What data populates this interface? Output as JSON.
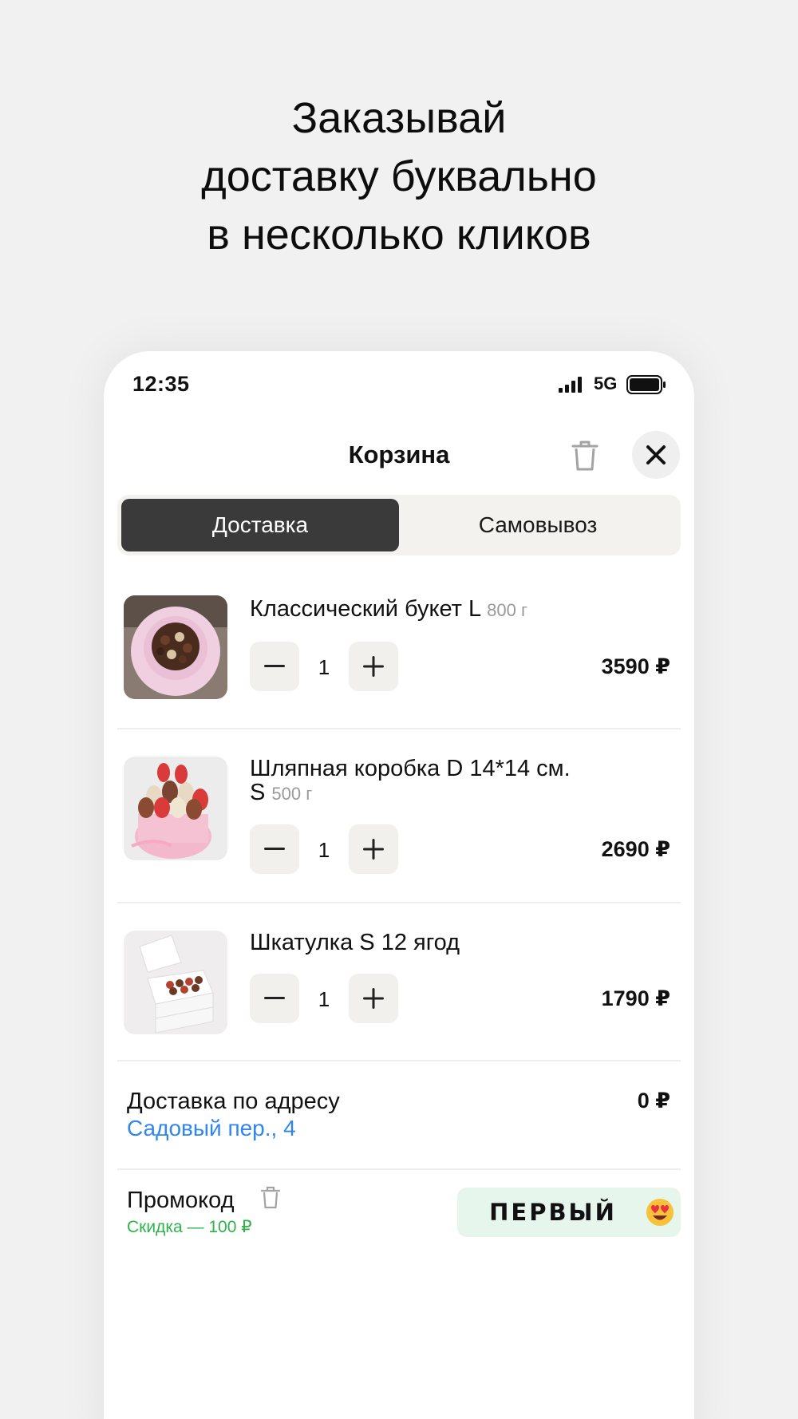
{
  "headline": {
    "line1": "Заказывай",
    "line2": "доставку буквально",
    "line3": "в несколько кликов"
  },
  "status_bar": {
    "time": "12:35",
    "network": "5G",
    "icons": [
      "signal-icon",
      "battery-icon"
    ]
  },
  "cart": {
    "title": "Корзина",
    "icons": [
      "trash-icon",
      "close-icon"
    ],
    "tabs": [
      {
        "label": "Доставка",
        "active": true
      },
      {
        "label": "Самовывоз",
        "active": false
      }
    ],
    "items": [
      {
        "name": "Классический букет L",
        "weight": "800 г",
        "qty": "1",
        "price": "3590 ₽"
      },
      {
        "name": "Шляпная коробка D 14*14 см.",
        "name_cont": "S",
        "weight": "500 г",
        "qty": "1",
        "price": "2690 ₽"
      },
      {
        "name": "Шкатулка S 12 ягод",
        "qty": "1",
        "price": "1790 ₽"
      }
    ],
    "delivery": {
      "label": "Доставка по адресу",
      "address": "Садовый пер., 4",
      "price": "0 ₽"
    },
    "promo": {
      "label": "Промокод",
      "discount": "Скидка — 100 ₽",
      "code": "ПЕРВЫЙ",
      "emoji": "heart-eyes-emoji"
    }
  },
  "colors": {
    "active_tab": "#3a3a3a",
    "link": "#2f86f0",
    "discount": "#2db34a",
    "promo_bg": "#e6f6ec"
  }
}
